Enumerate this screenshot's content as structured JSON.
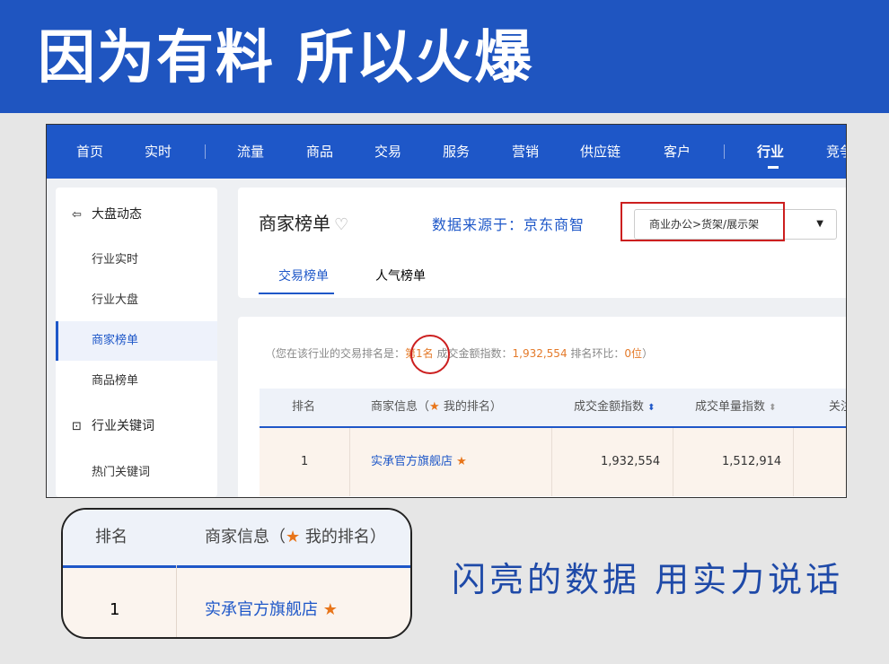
{
  "banner": {
    "title": "因为有料 所以火爆"
  },
  "nav": {
    "items": [
      "首页",
      "实时",
      "流量",
      "商品",
      "交易",
      "服务",
      "营销",
      "供应链",
      "客户",
      "行业",
      "竞争"
    ],
    "active": "行业"
  },
  "sidebar": {
    "section1": {
      "icon": "market-trend-icon",
      "label": "大盘动态"
    },
    "items": [
      "行业实时",
      "行业大盘",
      "商家榜单",
      "商品榜单"
    ],
    "active_item": "商家榜单",
    "section2": {
      "icon": "keyword-icon",
      "label": "行业关键词"
    },
    "items2": [
      "热门关键词"
    ]
  },
  "header": {
    "title": "商家榜单",
    "source_label": "数据来源于：京东商智",
    "category_select": "商业办公>货架/展示架",
    "tabs": [
      "交易榜单",
      "人气榜单"
    ],
    "active_tab": "交易榜单"
  },
  "summary": {
    "prefix": "（您在该行业的交易排名是：",
    "rank": "第1名",
    "amount_label": "成交金额指数：",
    "amount": "1,932,554",
    "change_label": "排名环比：",
    "change": "0位",
    "suffix": "）"
  },
  "table": {
    "columns": [
      "排名",
      "商家信息（",
      "我的排名）",
      "成交金额指数",
      "成交单量指数",
      "关注"
    ],
    "rows": [
      {
        "rank": "1",
        "shop": "实承官方旗舰店",
        "amount": "1,932,554",
        "orders": "1,512,914"
      }
    ]
  },
  "zoom": {
    "col_rank": "排名",
    "col_info_a": "商家信息（",
    "col_info_b": "我的排名）",
    "rank": "1",
    "shop": "实承官方旗舰店"
  },
  "slogan": "闪亮的数据 用实力说话",
  "colors": {
    "brand_blue": "#1e57c8",
    "highlight_orange": "#e47a2a",
    "annotation_red": "#cc1f1f"
  }
}
